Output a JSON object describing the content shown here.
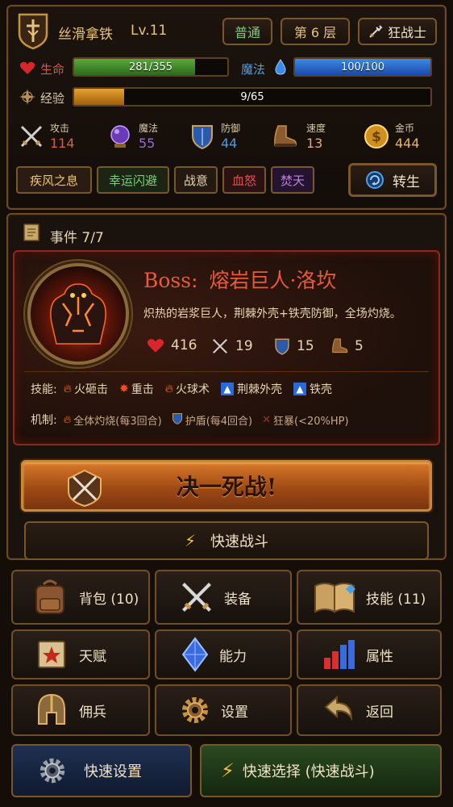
{
  "header": {
    "player_name": "丝滑拿铁",
    "level": "Lv.11",
    "difficulty": "普通",
    "floor": "第 6 层",
    "class_name": "狂战士"
  },
  "bars": {
    "hp_label": "生命",
    "hp_text": "281/355",
    "hp_fraction": 0.79,
    "mp_label": "魔法",
    "mp_text": "100/100",
    "mp_fraction": 1.0,
    "xp_label": "经验",
    "xp_text": "9/65",
    "xp_fraction": 0.14
  },
  "stats": [
    {
      "label": "攻击",
      "value": "114",
      "color": "#e05a3a"
    },
    {
      "label": "魔法",
      "value": "55",
      "color": "#9a6ad8"
    },
    {
      "label": "防御",
      "value": "44",
      "color": "#4a9ae8"
    },
    {
      "label": "速度",
      "value": "13",
      "color": "#e0b070"
    },
    {
      "label": "金币",
      "value": "444",
      "color": "#e8b850"
    }
  ],
  "tags": [
    {
      "label": "疾风之息",
      "color": "#e7c27a"
    },
    {
      "label": "幸运闪避",
      "color": "#7ad07a"
    },
    {
      "label": "战意",
      "color": "#e8d6b0"
    },
    {
      "label": "血怒",
      "color": "#e05050"
    },
    {
      "label": "焚天",
      "color": "#c080e0"
    }
  ],
  "rebirth_label": "转生",
  "event": {
    "title": "事件 7/7",
    "boss_prefix": "Boss:",
    "boss_name": "熔岩巨人·洛坎",
    "description": "炽热的岩浆巨人，荆棘外壳+铁壳防御，全场灼烧。",
    "hp": "416",
    "atk": "19",
    "def": "15",
    "spd": "5",
    "skills_label": "技能:",
    "skills": [
      "火砸击",
      "重击",
      "火球术",
      "荆棘外壳",
      "铁壳"
    ],
    "mech_label": "机制:",
    "mechanics": [
      "全体灼烧(每3回合)",
      "护盾(每4回合)",
      "狂暴(<20%HP)"
    ]
  },
  "fight_label": "决一死战!",
  "quick_fight_label": "快速战斗",
  "menu": {
    "bag": "背包 (10)",
    "equip": "装备",
    "skills": "技能 (11)",
    "talent": "天赋",
    "ability": "能力",
    "attributes": "属性",
    "mercenary": "佣兵",
    "settings": "设置",
    "back": "返回"
  },
  "bottom": {
    "quick_settings": "快速设置",
    "quick_select": "快速选择 (快速战斗)"
  }
}
